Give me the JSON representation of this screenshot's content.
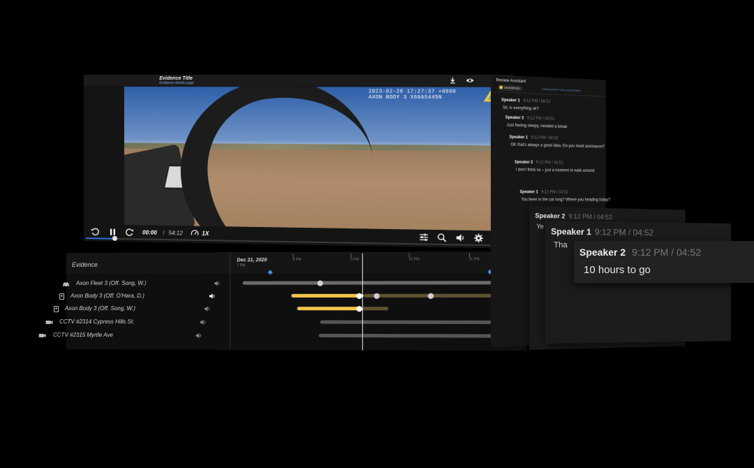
{
  "player": {
    "title": "Evidence Title",
    "subtitle": "Evidence details page",
    "timestamp_line1": "2023-02-28 17:27:37 +0000",
    "timestamp_line2": "AXON BODY 3 X60A5445N",
    "current_time": "00:00",
    "separator": "/",
    "total_time": "54:12",
    "speed": "1X",
    "progress_fraction": 0.07,
    "icons": [
      "download-icon",
      "eye-icon",
      "rewind-icon",
      "pause-icon",
      "forward-icon",
      "speed-icon",
      "adjust-icon",
      "zoom-icon",
      "volume-icon",
      "settings-icon",
      "fullscreen-icon"
    ]
  },
  "timeline": {
    "label": "Evidence",
    "date": "Dec 21, 2020",
    "date_sub": "7 PM",
    "ticks": [
      "8 PM",
      "9 PM",
      "10 PM",
      "11 PM"
    ],
    "rows": [
      {
        "label": "Axon Fleet 3 (Off. Song, W.)",
        "icon": "car-icon",
        "color": "#6a6a6a"
      },
      {
        "label": "Axon Body 3 (Off. O'Hara, D.)",
        "icon": "bodycam-icon",
        "color": "#f2c44c"
      },
      {
        "label": "Axon Body 3 (Off. Song, W.)",
        "icon": "bodycam-icon",
        "color": "#f2c44c"
      },
      {
        "label": "CCTV #2314 Cypress Hills St.",
        "icon": "camera-icon",
        "color": "#555555"
      },
      {
        "label": "CCTV #2315 Myrtle Ave",
        "icon": "camera-icon",
        "color": "#555555"
      }
    ]
  },
  "assistant": {
    "title": "Review Assistant",
    "badge": "UNVERIFIED",
    "tab": "TRANSCRIPTION ASSISTANT",
    "transcript": [
      {
        "speaker": "Speaker 1",
        "time": "9:12 PM / 04:52",
        "text": "Sir, is everything ok?"
      },
      {
        "speaker": "Speaker 2",
        "time": "9:12 PM / 04:52",
        "text": "Just feeling sleepy, needed a break"
      },
      {
        "speaker": "Speaker 1",
        "time": "9:12 PM / 04:52",
        "text": "OK that's always a good idea. Do you need assistance?"
      },
      {
        "speaker": "Speaker 2",
        "time": "9:12 PM / 04:52",
        "text": "I don't think so – just a moment to walk around"
      },
      {
        "speaker": "Speaker 1",
        "time": "9:12 PM / 04:52",
        "text": "You been in the car long? Where you heading today?"
      }
    ],
    "zoom_cards": [
      {
        "speaker": "Speaker 2",
        "time": "9:12 PM / 04:52",
        "text": "Ye"
      },
      {
        "speaker": "Speaker 1",
        "time": "9:12 PM / 04:52",
        "text": "Tha"
      },
      {
        "speaker": "Speaker 2",
        "time": "9:12 PM / 04:52",
        "text": "10 hours to go"
      }
    ]
  }
}
